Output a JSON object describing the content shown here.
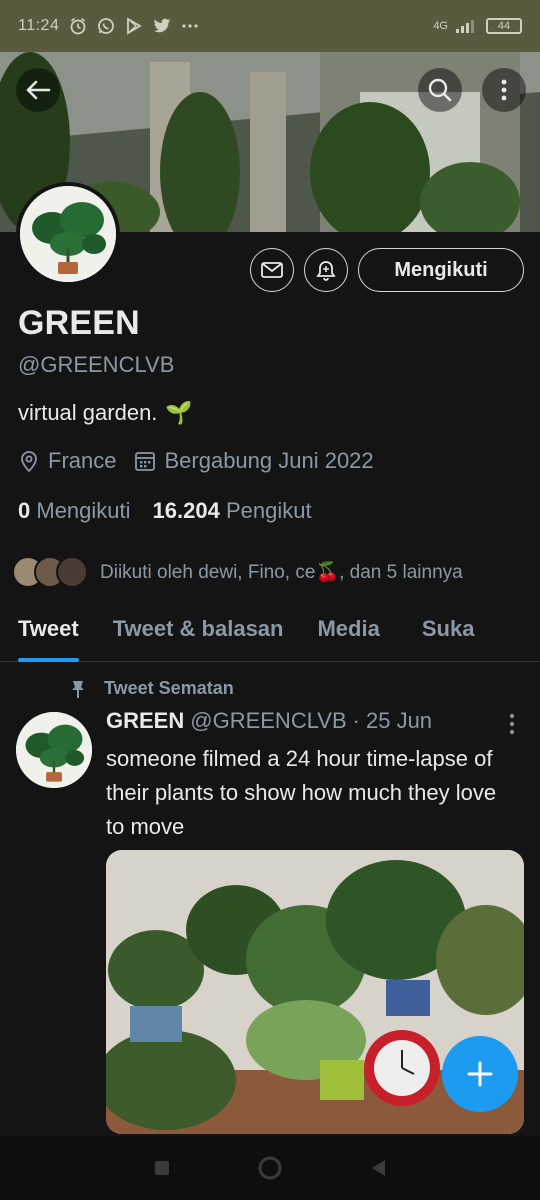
{
  "status_bar": {
    "time": "11:24",
    "icons": [
      "alarm-icon",
      "whatsapp-icon",
      "play-store-icon",
      "twitter-icon",
      "more-dots-icon"
    ],
    "network": "4G",
    "battery": "44"
  },
  "banner": {
    "back_icon": "arrow-left-icon",
    "search_icon": "search-icon",
    "more_icon": "more-vertical-icon"
  },
  "profile": {
    "name": "GREEN",
    "handle": "@GREENCLVB",
    "bio": "virtual garden.",
    "bio_emoji": "🌱",
    "location": "France",
    "joined": "Bergabung Juni 2022",
    "following_count": "0",
    "following_label": "Mengikuti",
    "followers_count": "16.204",
    "followers_label": "Pengikut",
    "followed_by": "Diikuti oleh dewi, Fino, ce",
    "followed_by_emoji": "🍒",
    "followed_by_rest": ", dan 5 lainnya"
  },
  "actions": {
    "message_icon": "mail-icon",
    "notify_icon": "bell-plus-icon",
    "follow_label": "Mengikuti"
  },
  "tabs": [
    {
      "label": "Tweet",
      "active": true
    },
    {
      "label": "Tweet & balasan",
      "active": false
    },
    {
      "label": "Media",
      "active": false
    },
    {
      "label": "Suka",
      "active": false
    }
  ],
  "tweet": {
    "pinned_label": "Tweet Sematan",
    "name": "GREEN",
    "handle": "@GREENCLVB",
    "separator": "·",
    "date": "25 Jun",
    "text": "someone filmed a 24 hour time-lapse of their plants to show how much they love to move"
  },
  "colors": {
    "accent": "#1d9bf0",
    "background": "#141414",
    "status_bar": "#5a5a3f",
    "muted_text": "#8b98a5"
  },
  "nav": [
    "recents-square-icon",
    "home-circle-icon",
    "back-triangle-icon"
  ]
}
